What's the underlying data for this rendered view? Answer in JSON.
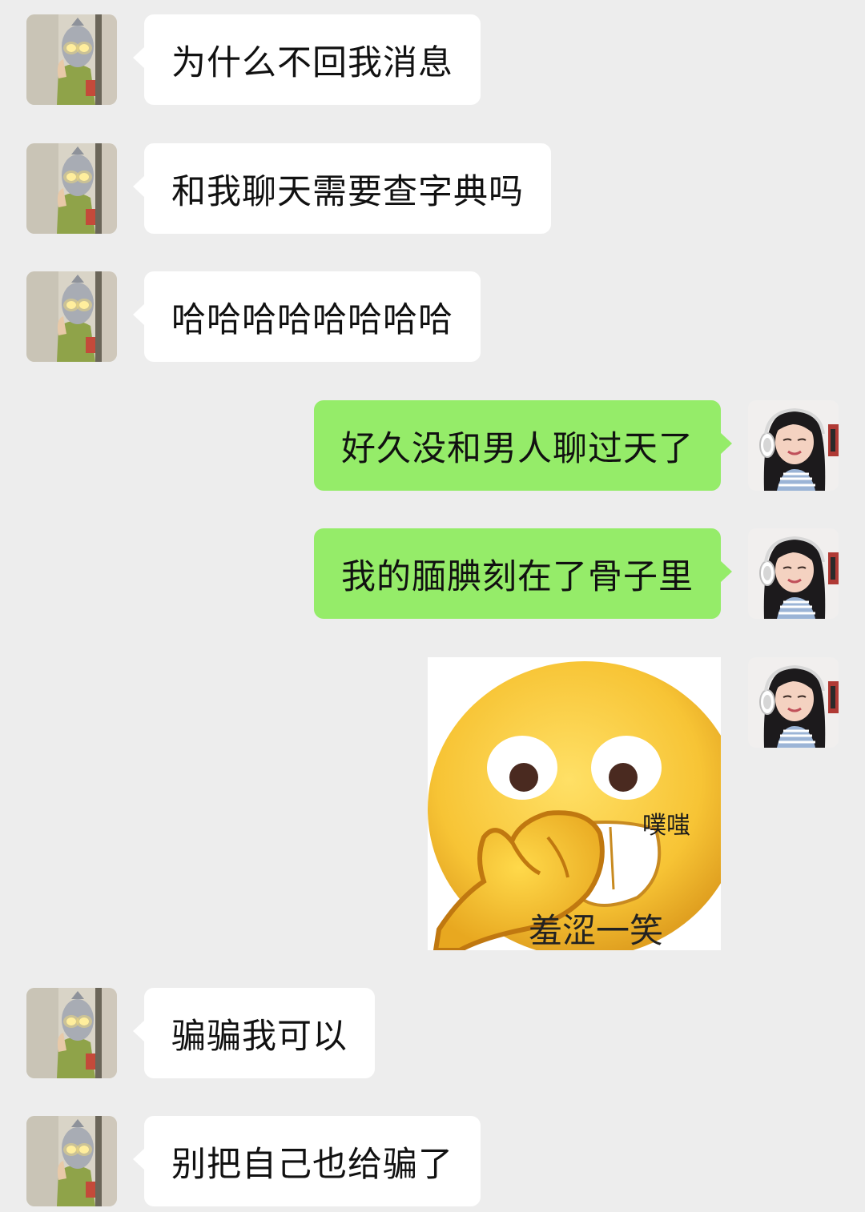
{
  "chat": {
    "messages": [
      {
        "sender": "other",
        "text": "为什么不回我消息"
      },
      {
        "sender": "other",
        "text": "和我聊天需要查字典吗"
      },
      {
        "sender": "other",
        "text": "哈哈哈哈哈哈哈哈"
      },
      {
        "sender": "me",
        "text": "好久没和男人聊过天了"
      },
      {
        "sender": "me",
        "text": "我的腼腆刻在了骨子里"
      },
      {
        "sender": "me",
        "type": "sticker",
        "sticker_text_top": "噗嗤",
        "sticker_text_bottom": "羞涩一笑"
      },
      {
        "sender": "other",
        "text": "骗骗我可以"
      },
      {
        "sender": "other",
        "text": "别把自己也给骗了"
      }
    ]
  },
  "colors": {
    "background": "#ededed",
    "incoming_bubble": "#ffffff",
    "outgoing_bubble": "#95ec69",
    "text": "#111111"
  }
}
